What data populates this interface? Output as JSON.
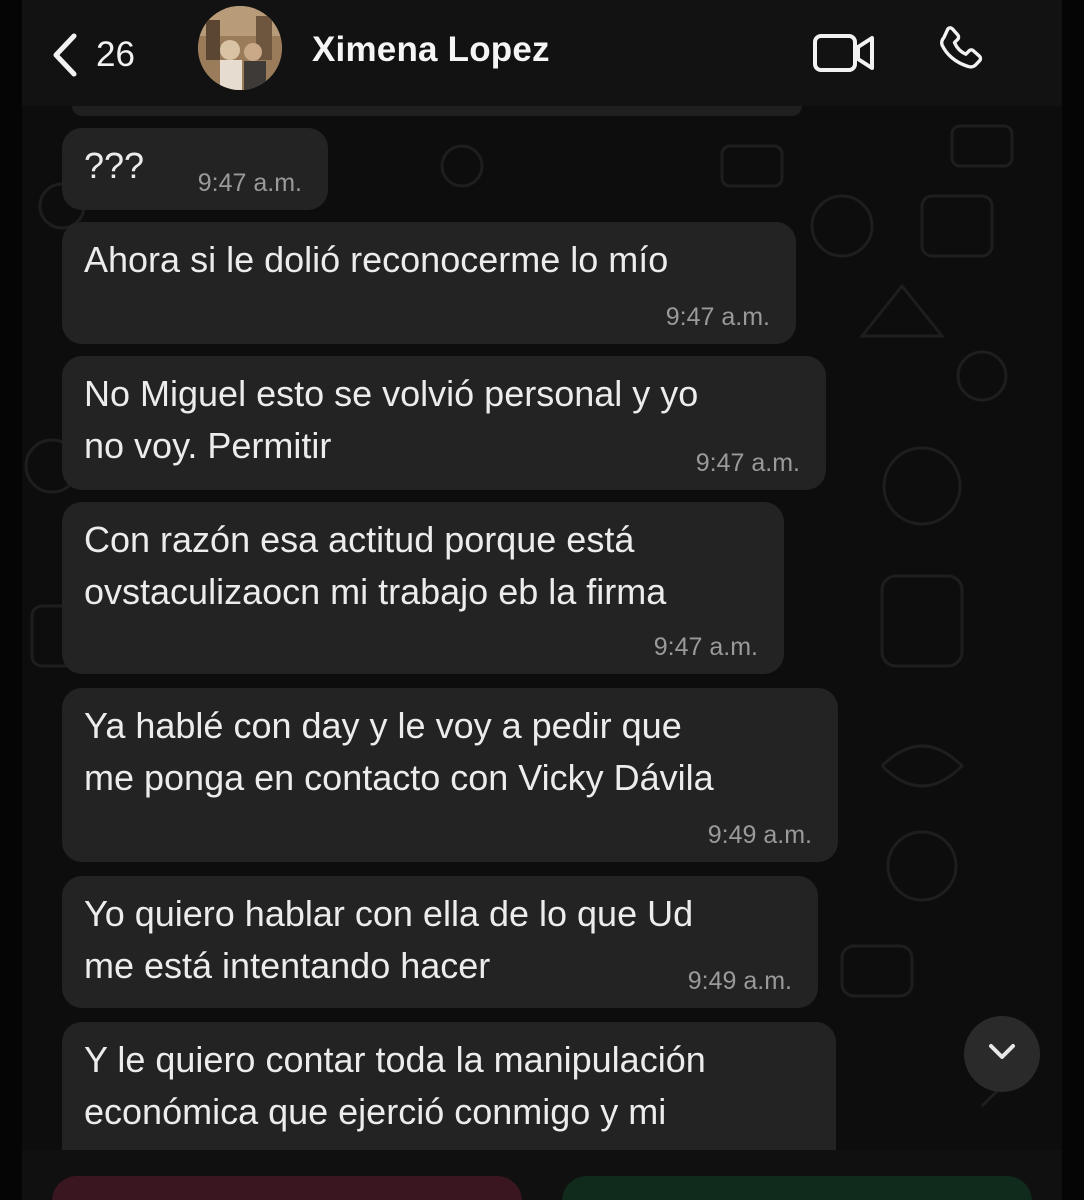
{
  "header": {
    "back_icon": "chevron-left-icon",
    "unread_count": "26",
    "contact_name": "Ximena Lopez",
    "video_icon": "video-camera-icon",
    "call_icon": "phone-icon"
  },
  "messages": [
    {
      "text": "???",
      "time": "9:47 a.m."
    },
    {
      "text": "Ahora si le dolió reconocerme lo mío",
      "time": "9:47 a.m."
    },
    {
      "text": "No Miguel esto se volvió personal y yo\nno voy. Permitir",
      "time": "9:47 a.m."
    },
    {
      "text": "Con razón esa actitud porque está\novstaculizaocn mi trabajo eb la firma",
      "time": "9:47 a.m."
    },
    {
      "text": "Ya hablé con day y le voy a pedir que\nme ponga en contacto con Vicky Dávila",
      "time": "9:49 a.m."
    },
    {
      "text": "Yo quiero hablar con ella de lo que Ud\nme está intentando hacer",
      "time": "9:49 a.m."
    },
    {
      "text": "Y le quiero contar toda la manipulación\neconómica que ejerció conmigo y mi",
      "time": ""
    }
  ],
  "scroll_icon": "chevron-down-icon",
  "colors": {
    "background": "#0d0d0d",
    "bubble": "#232323",
    "text": "#ececec",
    "timestamp": "#9a9a9a",
    "block_button": "#3a1620",
    "accept_button": "#102a1c"
  }
}
